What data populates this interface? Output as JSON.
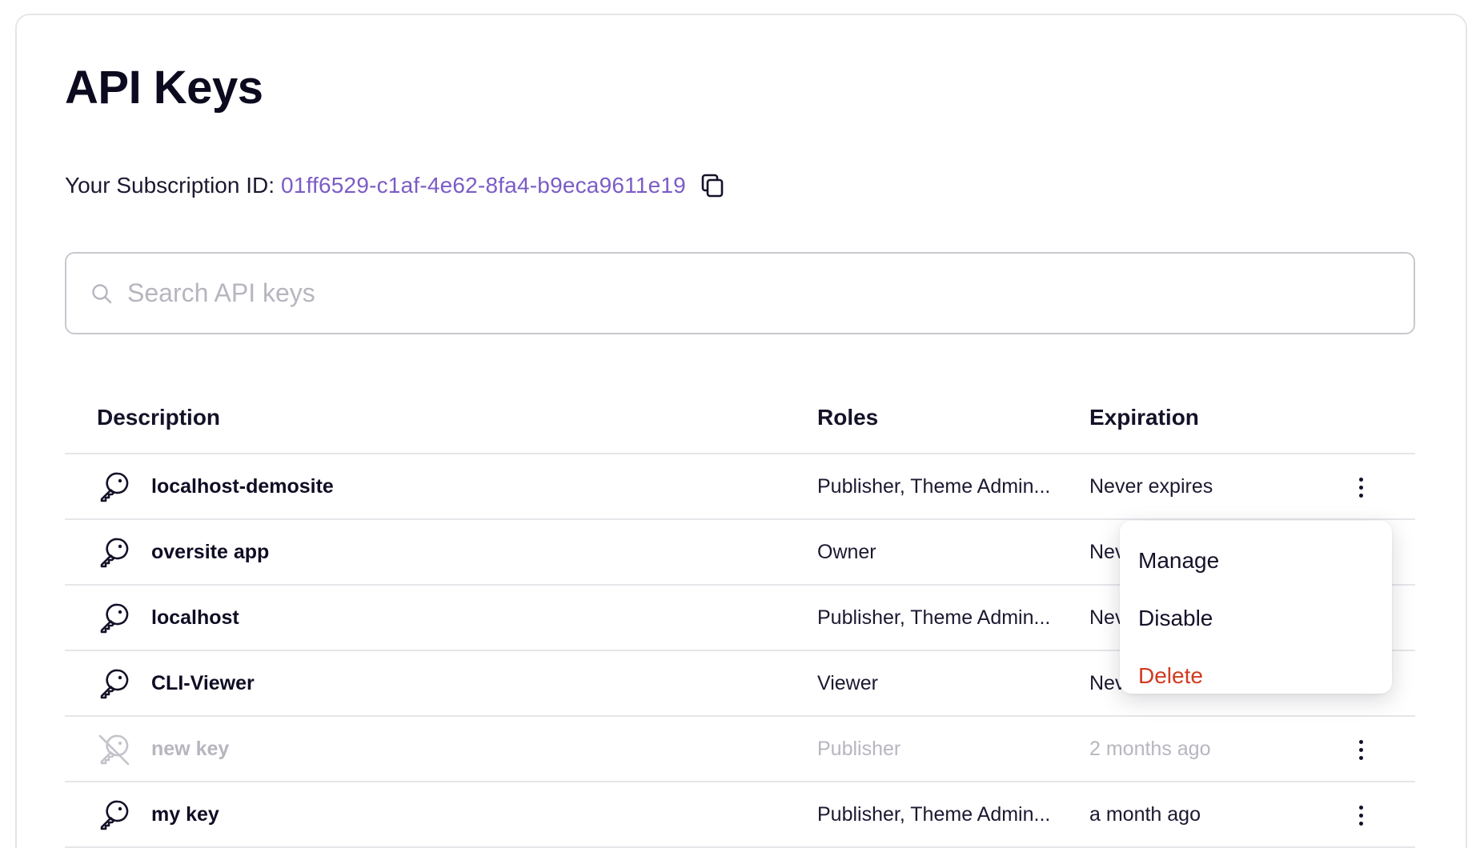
{
  "page": {
    "title": "API Keys"
  },
  "subscription": {
    "label": "Your Subscription ID:",
    "id": "01ff6529-c1af-4e62-8fa4-b9eca9611e19",
    "copy_icon": "copy-icon"
  },
  "search": {
    "placeholder": "Search API keys",
    "value": "",
    "icon": "search-icon"
  },
  "table": {
    "headers": {
      "description": "Description",
      "roles": "Roles",
      "expiration": "Expiration"
    },
    "rows": [
      {
        "name": "localhost-demosite",
        "roles": "Publisher, Theme Admin...",
        "expiration": "Never expires",
        "icon": "key-icon",
        "disabled": false
      },
      {
        "name": "oversite app",
        "roles": "Owner",
        "expiration": "Nev",
        "icon": "key-icon",
        "disabled": false
      },
      {
        "name": "localhost",
        "roles": "Publisher, Theme Admin...",
        "expiration": "Nev",
        "icon": "key-icon",
        "disabled": false
      },
      {
        "name": "CLI-Viewer",
        "roles": "Viewer",
        "expiration": "Nev",
        "icon": "key-icon",
        "disabled": false
      },
      {
        "name": "new key",
        "roles": "Publisher",
        "expiration": "2 months ago",
        "icon": "key-off-icon",
        "disabled": true
      },
      {
        "name": "my key",
        "roles": "Publisher, Theme Admin...",
        "expiration": "a month ago",
        "icon": "key-icon",
        "disabled": false
      }
    ]
  },
  "row_menu": {
    "items": [
      {
        "label": "Manage"
      },
      {
        "label": "Disable"
      },
      {
        "label": "Delete",
        "danger": true
      }
    ],
    "danger_color": "#d23a1f"
  },
  "colors": {
    "accent": "#7b5cc6",
    "text": "#141228",
    "muted": "#b7b6bf",
    "border": "#e6e6ea"
  }
}
